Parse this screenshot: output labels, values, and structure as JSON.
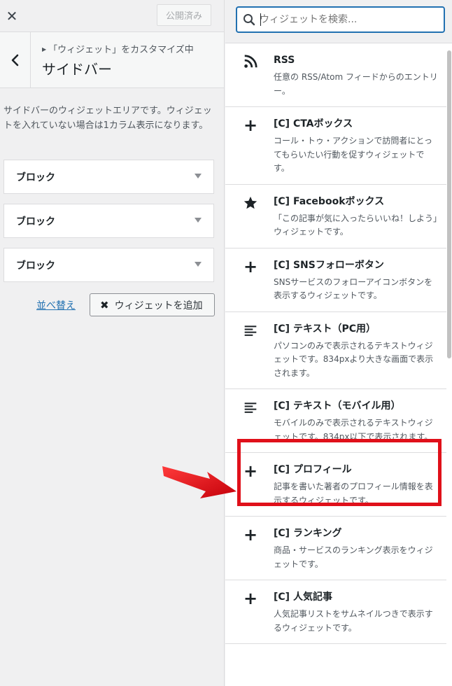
{
  "customizer": {
    "close_icon": "close-icon",
    "publish_label": "公開済み",
    "breadcrumb": "「ウィジェット」をカスタマイズ中",
    "section_title": "サイドバー",
    "description": "サイドバーのウィジェットエリアです。ウィジェットを入れていない場合は1カラム表示になります。",
    "blocks": [
      {
        "label": "ブロック"
      },
      {
        "label": "ブロック"
      },
      {
        "label": "ブロック"
      }
    ],
    "reorder_label": "並べ替え",
    "add_widget_label": "ウィジェットを追加"
  },
  "widget_panel": {
    "search_placeholder": "ウィジェットを検索...",
    "widgets": [
      {
        "icon": "rss-icon",
        "title": "RSS",
        "description": "任意の RSS/Atom フィードからのエントリー。"
      },
      {
        "icon": "plus-icon",
        "title": "[C] CTAボックス",
        "description": "コール・トゥ・アクションで訪問者にとってもらいたい行動を促すウィジェットです。"
      },
      {
        "icon": "star-icon",
        "title": "[C] Facebookボックス",
        "description": "「この記事が気に入ったらいいね！しよう」ウィジェットです。"
      },
      {
        "icon": "plus-icon",
        "title": "[C] SNSフォローボタン",
        "description": "SNSサービスのフォローアイコンボタンを表示するウィジェットです。"
      },
      {
        "icon": "text-align-icon",
        "title": "[C] テキスト（PC用）",
        "description": "パソコンのみで表示されるテキストウィジェットです。834pxより大きな画面で表示されます。"
      },
      {
        "icon": "text-align-icon",
        "title": "[C] テキスト（モバイル用）",
        "description": "モバイルのみで表示されるテキストウィジェットです。834px以下で表示されます。"
      },
      {
        "icon": "plus-icon",
        "title": "[C] プロフィール",
        "description": "記事を書いた著者のプロフィール情報を表示するウィジェットです。"
      },
      {
        "icon": "plus-icon",
        "title": "[C] ランキング",
        "description": "商品・サービスのランキング表示をウィジェットです。"
      },
      {
        "icon": "plus-icon",
        "title": "[C] 人気記事",
        "description": "人気記事リストをサムネイルつきで表示するウィジェットです。"
      }
    ]
  },
  "colors": {
    "accent": "#2271b1",
    "highlight": "#e0101a"
  }
}
